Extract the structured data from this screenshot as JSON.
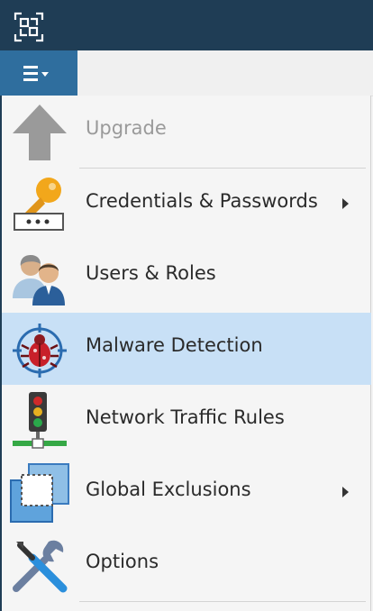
{
  "window": {
    "app_icon": "scan-icon"
  },
  "menubar": {
    "menu_button_icon": "hamburger-menu-icon"
  },
  "menu": {
    "items": [
      {
        "label": "Upgrade",
        "icon": "upgrade-arrow-icon",
        "disabled": true,
        "submenu": false
      },
      {
        "label": "Credentials & Passwords",
        "icon": "key-icon",
        "disabled": false,
        "submenu": true
      },
      {
        "label": "Users & Roles",
        "icon": "users-icon",
        "disabled": false,
        "submenu": false
      },
      {
        "label": "Malware Detection",
        "icon": "bug-target-icon",
        "disabled": false,
        "submenu": false,
        "selected": true
      },
      {
        "label": "Network Traffic Rules",
        "icon": "traffic-light-icon",
        "disabled": false,
        "submenu": false
      },
      {
        "label": "Global Exclusions",
        "icon": "exclusion-square-icon",
        "disabled": false,
        "submenu": true
      },
      {
        "label": "Options",
        "icon": "tools-icon",
        "disabled": false,
        "submenu": false
      }
    ]
  },
  "colors": {
    "titlebar": "#1f3d55",
    "menu_button": "#2f6e9e",
    "selected_row": "#c8e0f6"
  }
}
